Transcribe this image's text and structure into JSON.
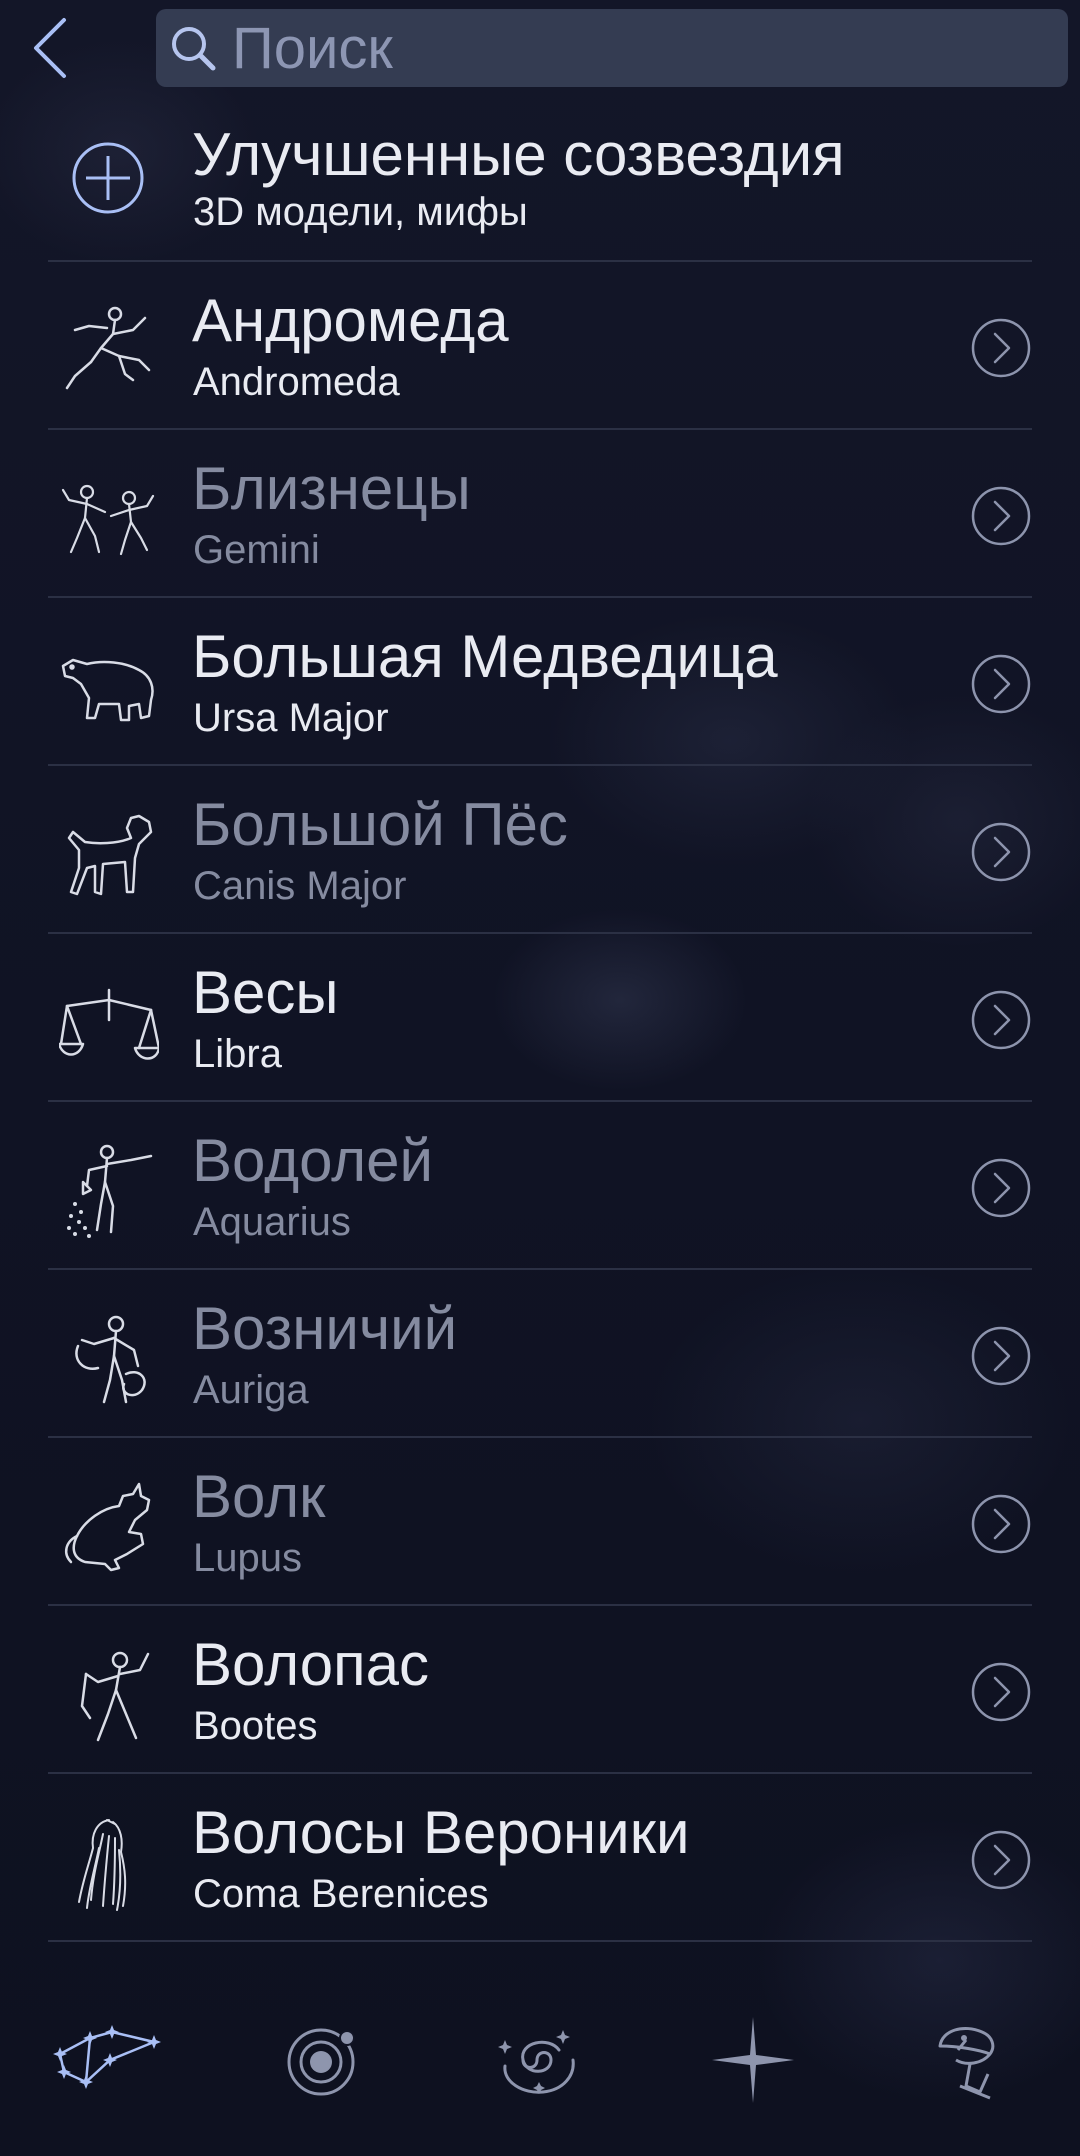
{
  "search": {
    "placeholder": "Поиск"
  },
  "featured": {
    "title": "Улучшенные созвездия",
    "subtitle": "3D модели, мифы"
  },
  "constellations": [
    {
      "name": "Андромеда",
      "latin": "Andromeda",
      "highlighted": true
    },
    {
      "name": "Близнецы",
      "latin": "Gemini",
      "highlighted": false
    },
    {
      "name": "Большая Медведица",
      "latin": "Ursa Major",
      "highlighted": true
    },
    {
      "name": "Большой Пёс",
      "latin": "Canis Major",
      "highlighted": false
    },
    {
      "name": "Весы",
      "latin": "Libra",
      "highlighted": true
    },
    {
      "name": "Водолей",
      "latin": "Aquarius",
      "highlighted": false
    },
    {
      "name": "Возничий",
      "latin": "Auriga",
      "highlighted": false
    },
    {
      "name": "Волк",
      "latin": "Lupus",
      "highlighted": false
    },
    {
      "name": "Волопас",
      "latin": "Bootes",
      "highlighted": true
    },
    {
      "name": "Волосы Вероники",
      "latin": "Coma Berenices",
      "highlighted": true
    }
  ],
  "figure_icons": [
    "andromeda-figure-icon",
    "gemini-figure-icon",
    "ursa-major-bear-icon",
    "canis-major-dog-icon",
    "libra-scales-icon",
    "aquarius-figure-icon",
    "auriga-figure-icon",
    "lupus-wolf-icon",
    "bootes-figure-icon",
    "coma-berenices-hair-icon"
  ],
  "bottom_nav": [
    {
      "icon": "constellations-icon",
      "active": true
    },
    {
      "icon": "solar-system-icon",
      "active": false
    },
    {
      "icon": "deep-sky-galaxy-icon",
      "active": false
    },
    {
      "icon": "star-icon",
      "active": false
    },
    {
      "icon": "satellite-icon",
      "active": false
    }
  ],
  "colors": {
    "background": "#111425",
    "search_field": "#343c52",
    "text_bright": "#e9ebf2",
    "text_dim": "#858ba0",
    "accent": "#a9bff5",
    "divider": "#2b3044"
  }
}
